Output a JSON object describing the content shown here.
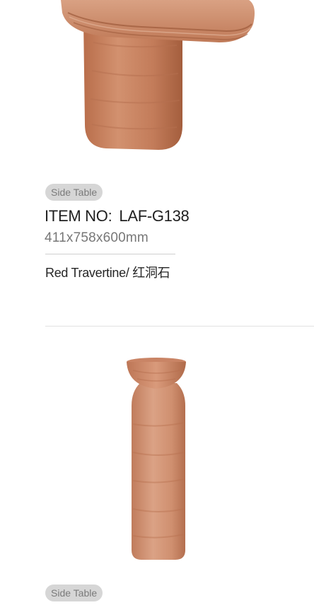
{
  "products": [
    {
      "category": "Side Table",
      "item_label": "ITEM NO:",
      "item_no": "LAF-G138",
      "dimensions": "411x758x600mm",
      "material": "Red Travertine/ 红洞石"
    },
    {
      "category": "Side Table"
    }
  ],
  "colors": {
    "stone_light": "#d99c7e",
    "stone_mid": "#c98160",
    "stone_dark": "#a7613f",
    "badge_bg": "#d6d6d6",
    "badge_text": "#7a7a7a"
  }
}
